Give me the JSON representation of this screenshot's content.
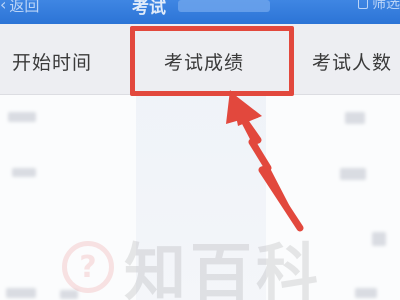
{
  "topbar": {
    "back_label": "返回",
    "back_icon": "chevron-left-icon",
    "title": "考试",
    "filter_label": "筛选",
    "filter_icon": "filter-icon",
    "background_color": "#2f78da"
  },
  "table": {
    "columns": [
      {
        "label": "开始时间"
      },
      {
        "label": "考试成绩"
      },
      {
        "label": "考试人数"
      }
    ],
    "highlighted_column": "考试成绩"
  },
  "annotation": {
    "highlight_color": "#e2483d",
    "arrow_color": "#e2483d"
  },
  "watermark": {
    "text": "知百科"
  }
}
